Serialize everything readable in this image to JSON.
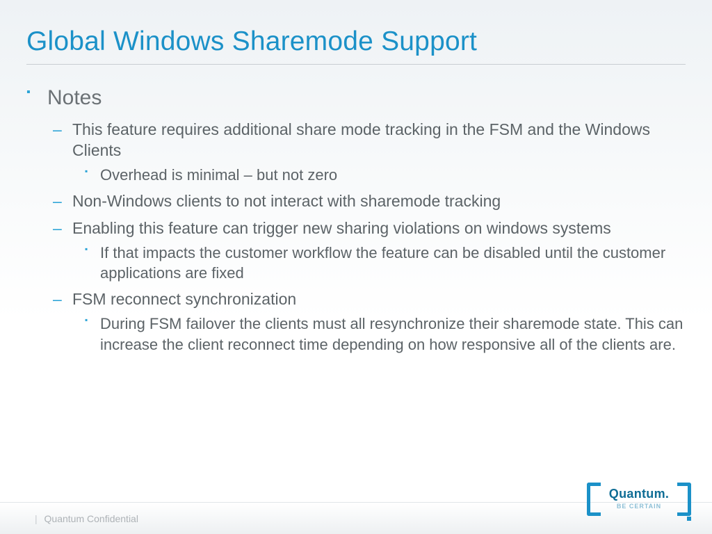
{
  "title": "Global Windows Sharemode Support",
  "section": "Notes",
  "bullets": {
    "b1": "This feature requires additional share mode tracking in the FSM and the Windows Clients",
    "b1a": "Overhead is minimal – but not zero",
    "b2": "Non-Windows clients to not interact with sharemode tracking",
    "b3": "Enabling this feature can trigger new sharing violations on windows systems",
    "b3a": "If that impacts the customer workflow the feature can be disabled until the customer applications are fixed",
    "b4": "FSM reconnect synchronization",
    "b4a": "During FSM failover the clients must all resynchronize their sharemode state. This can increase the client reconnect time depending on how responsive all of the clients are."
  },
  "footer": "Quantum Confidential",
  "logo": {
    "name": "Quantum.",
    "tag": "BE CERTAIN"
  }
}
